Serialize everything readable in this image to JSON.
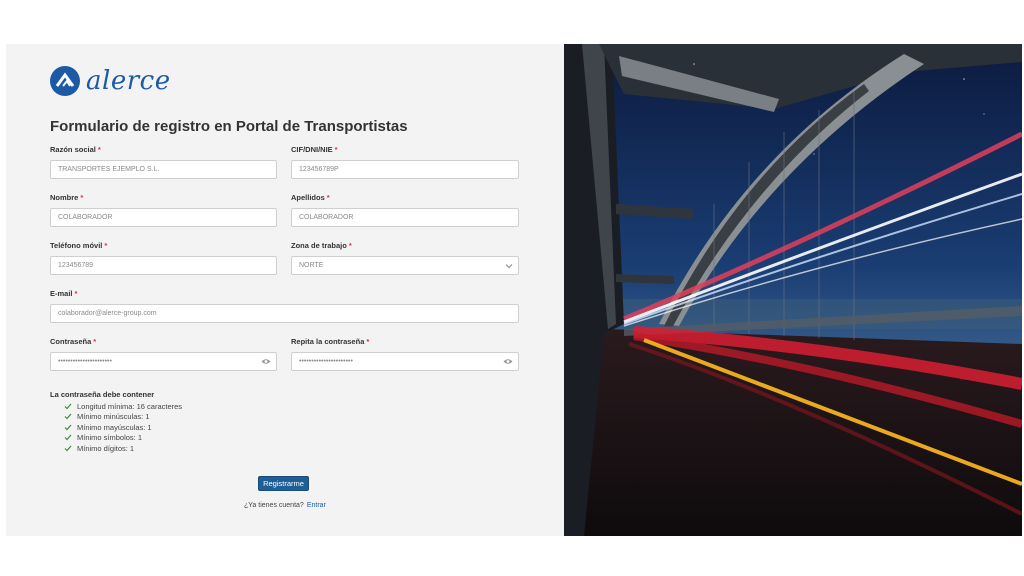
{
  "brand": {
    "name": "alerce"
  },
  "form": {
    "title": "Formulario de registro en Portal de Transportistas",
    "required_mark": "*",
    "fields": {
      "razon_social": {
        "label": "Razón social",
        "value": "TRANSPORTES EJEMPLO S.L."
      },
      "cif": {
        "label": "CIF/DNI/NIE",
        "value": "123456789P"
      },
      "nombre": {
        "label": "Nombre",
        "value": "COLABORADOR"
      },
      "apellidos": {
        "label": "Apellidos",
        "value": "COLABORADOR"
      },
      "telefono": {
        "label": "Teléfono móvil",
        "value": "123456789"
      },
      "zona": {
        "label": "Zona de trabajo",
        "value": "NORTE"
      },
      "email": {
        "label": "E-mail",
        "value": "colaborador@alerce-group.com"
      },
      "password": {
        "label": "Contraseña",
        "value": "••••••••••••••••••••••"
      },
      "password_repeat": {
        "label": "Repita la contraseña",
        "value": "••••••••••••••••••••••"
      }
    },
    "rules": {
      "title": "La contraseña debe contener",
      "items": [
        "Longitud mínima: 16 caracteres",
        "Mínimo minúsculas: 1",
        "Mínimo mayúsculas: 1",
        "Mínimo símbolos: 1",
        "Mínimo dígitos: 1"
      ]
    },
    "submit_label": "Registrarme",
    "login_prompt": "¿Ya tienes cuenta?",
    "login_link": "Entrar"
  },
  "colors": {
    "brand_blue": "#1d5aa6",
    "button_blue": "#1f5f96",
    "required_red": "#d23a3a",
    "check_green": "#3b8a3e"
  },
  "icons": {
    "logo": "alerce-logo-icon",
    "show_password": "eye-icon",
    "select_caret": "chevron-down-icon",
    "rule_check": "check-icon"
  }
}
